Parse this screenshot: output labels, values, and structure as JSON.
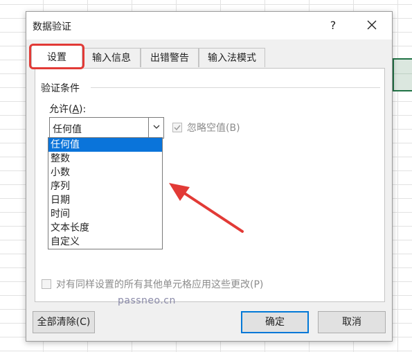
{
  "dialog": {
    "title": "数据验证",
    "help_label": "?"
  },
  "tabs": [
    {
      "label": "设置",
      "active": true
    },
    {
      "label": "输入信息",
      "active": false
    },
    {
      "label": "出错警告",
      "active": false
    },
    {
      "label": "输入法模式",
      "active": false
    }
  ],
  "settings": {
    "group_title": "验证条件",
    "allow_label_prefix": "允许(",
    "allow_label_key": "A",
    "allow_label_suffix": "):",
    "allow_value": "任何值",
    "ignore_blank_label": "忽略空值(B)",
    "ignore_blank_checked": true,
    "ignore_blank_enabled": false,
    "apply_all_label": "对有同样设置的所有其他单元格应用这些更改(P)",
    "apply_all_checked": false
  },
  "dropdown": {
    "options": [
      "任何值",
      "整数",
      "小数",
      "序列",
      "日期",
      "时间",
      "文本长度",
      "自定义"
    ],
    "selected_index": 0
  },
  "buttons": {
    "clear_all": "全部清除(C)",
    "ok": "确定",
    "cancel": "取消"
  },
  "watermark": "passneo.cn",
  "colors": {
    "annotation_red": "#e23a36",
    "selection_blue": "#0a74da",
    "default_button_border": "#0078d7",
    "sheet_selection_green": "#217346"
  }
}
